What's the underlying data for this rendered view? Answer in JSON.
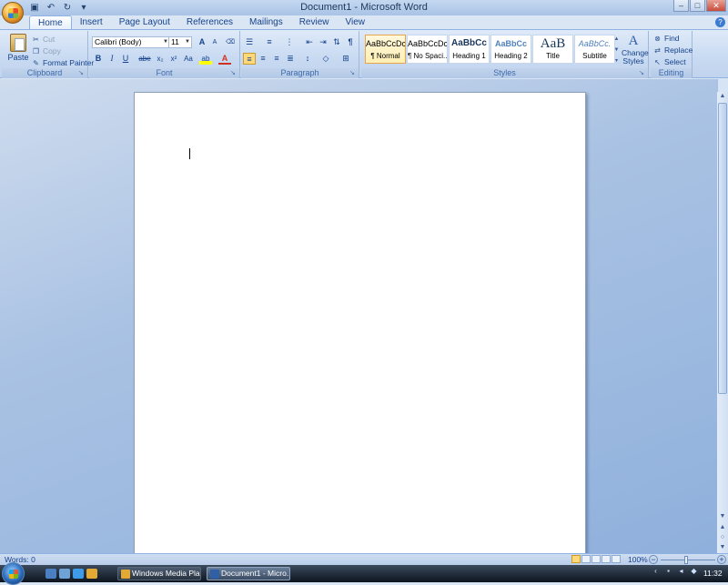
{
  "window": {
    "title": "Document1 - Microsoft Word",
    "controls": {
      "minimize": "–",
      "maximize": "□",
      "close": "✕"
    }
  },
  "quick_access": {
    "save_icon": "save-icon",
    "undo_icon": "undo-icon",
    "redo_icon": "redo-icon",
    "customize": "▾"
  },
  "tabs": [
    "Home",
    "Insert",
    "Page Layout",
    "References",
    "Mailings",
    "Review",
    "View"
  ],
  "active_tab": "Home",
  "help": "?",
  "clipboard": {
    "group_label": "Clipboard",
    "paste": "Paste",
    "cut": "Cut",
    "copy": "Copy",
    "format_painter": "Format Painter"
  },
  "font": {
    "group_label": "Font",
    "family": "Calibri (Body)",
    "size": "11",
    "grow": "A",
    "shrink": "A",
    "bold": "B",
    "italic": "I",
    "underline": "U",
    "strike": "abe",
    "subscript": "x₂",
    "superscript": "x²",
    "change_case": "Aa",
    "highlight": "ab",
    "font_color": "A",
    "font_color_value": "#d03020"
  },
  "paragraph": {
    "group_label": "Paragraph",
    "show_marks": "¶"
  },
  "styles": {
    "group_label": "Styles",
    "items": [
      {
        "sample": "AaBbCcDc",
        "name": "¶ Normal"
      },
      {
        "sample": "AaBbCcDc",
        "name": "¶ No Spaci..."
      },
      {
        "sample": "AaBbCc",
        "name": "Heading 1"
      },
      {
        "sample": "AaBbCc",
        "name": "Heading 2"
      },
      {
        "sample": "AaB",
        "name": "Title"
      },
      {
        "sample": "AaBbCc.",
        "name": "Subtitle"
      }
    ],
    "change_styles_line1": "Change",
    "change_styles_line2": "Styles"
  },
  "editing": {
    "group_label": "Editing",
    "find": "Find",
    "replace": "Replace",
    "select": "Select"
  },
  "status": {
    "words": "Words: 0",
    "zoom": "100%",
    "zoom_minus": "−",
    "zoom_plus": "+"
  },
  "taskbar": {
    "buttons": [
      "Windows Media Pla...",
      "Document1 - Micro..."
    ],
    "clock": "11:32"
  }
}
